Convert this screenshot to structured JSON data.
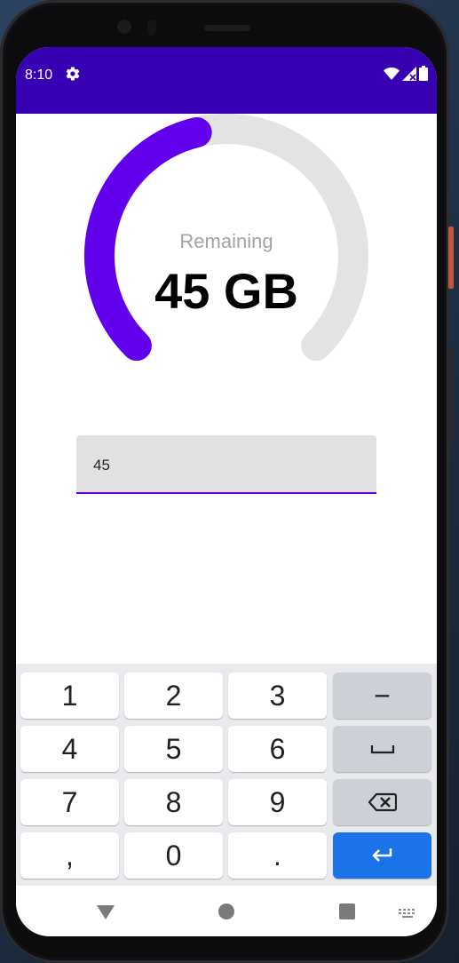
{
  "status_bar": {
    "time": "8:10",
    "background_color": "#3700b3",
    "icons": [
      "settings-icon",
      "wifi-icon",
      "cellular-signal-icon",
      "battery-icon"
    ]
  },
  "gauge": {
    "caption": "Remaining",
    "value_text": "45 GB",
    "level_percent": 45,
    "progress_color": "#6200ee",
    "track_color": "#e3e3e3"
  },
  "input": {
    "value": "45",
    "underline_color": "#6200ee"
  },
  "keyboard": {
    "rows": [
      [
        "1",
        "2",
        "3",
        "−"
      ],
      [
        "4",
        "5",
        "6",
        "space-icon"
      ],
      [
        "7",
        "8",
        "9",
        "backspace-icon"
      ],
      [
        ",",
        "0",
        ".",
        "enter-icon"
      ]
    ],
    "enter_color": "#1a73e8"
  },
  "nav_bar": {
    "icons": [
      "back-icon",
      "home-icon",
      "recents-icon",
      "keyboard-switch-icon"
    ]
  }
}
